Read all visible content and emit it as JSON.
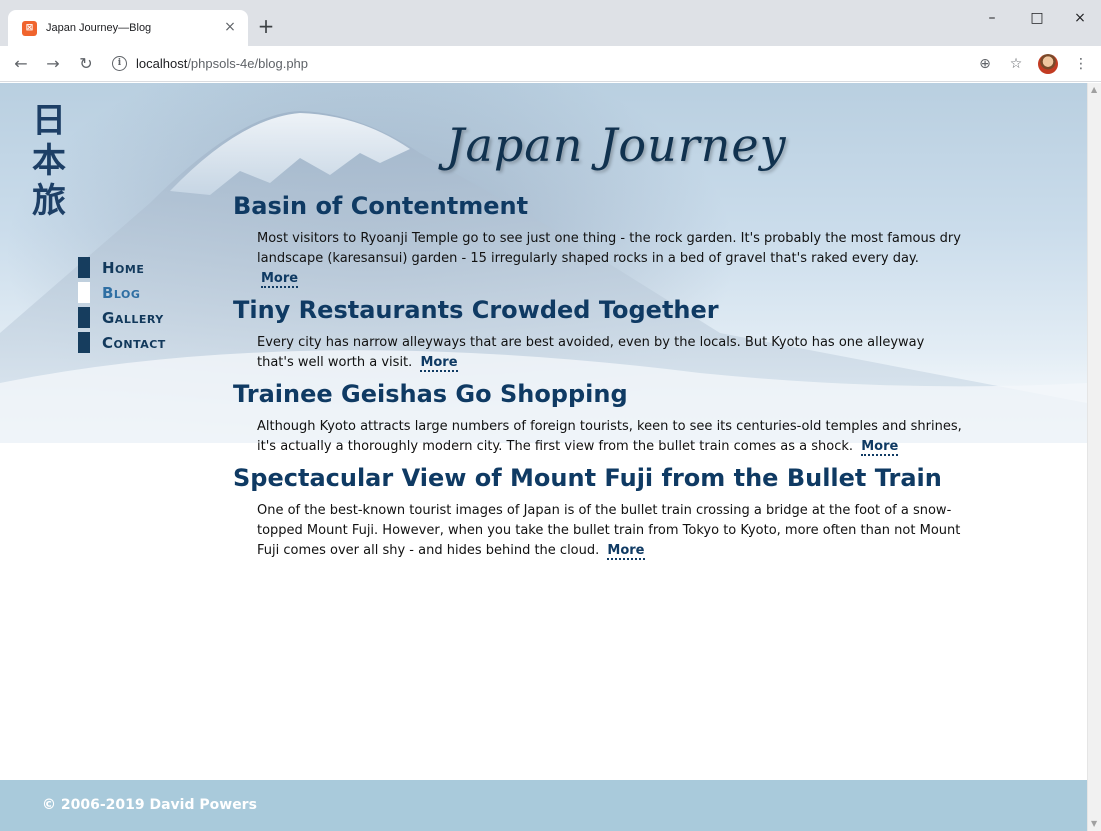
{
  "browser": {
    "tab_title": "Japan Journey—Blog",
    "tab_close": "×",
    "new_tab": "+",
    "url_host": "localhost",
    "url_path": "/phpsols-4e/blog.php",
    "back_icon": "arrow-left-icon",
    "forward_icon": "arrow-right-icon",
    "reload_icon": "reload-icon",
    "window_controls": [
      "–",
      "□",
      "×"
    ]
  },
  "site": {
    "logo_kanji": [
      "日",
      "本",
      "旅"
    ],
    "title": "Japan Journey"
  },
  "nav": {
    "items": [
      {
        "label": "Home",
        "current": false
      },
      {
        "label": "Blog",
        "current": true
      },
      {
        "label": "Gallery",
        "current": false
      },
      {
        "label": "Contact",
        "current": false
      }
    ]
  },
  "posts": [
    {
      "title": "Basin of Contentment",
      "body": "Most visitors to Ryoanji Temple go to see just one thing - the rock garden. It's probably the most famous dry landscape (karesansui) garden - 15 irregularly shaped rocks in a bed of gravel that's raked every day.",
      "more": "More"
    },
    {
      "title": "Tiny Restaurants Crowded Together",
      "body": "Every city has narrow alleyways that are best avoided, even by the locals. But Kyoto has one alleyway that's well worth a visit.",
      "more": "More"
    },
    {
      "title": "Trainee Geishas Go Shopping",
      "body": "Although Kyoto attracts large numbers of foreign tourists, keen to see its centuries-old temples and shrines, it's actually a thoroughly modern city. The first view from the bullet train comes as a shock.",
      "more": "More"
    },
    {
      "title": "Spectacular View of Mount Fuji from the Bullet Train",
      "body": "One of the best-known tourist images of Japan is of the bullet train crossing a bridge at the foot of a snow-topped Mount Fuji. However, when you take the bullet train from Tokyo to Kyoto, more often than not Mount Fuji comes over all shy - and hides behind the cloud.",
      "more": "More"
    }
  ],
  "footer": {
    "text": "© 2006-2019 David Powers"
  }
}
